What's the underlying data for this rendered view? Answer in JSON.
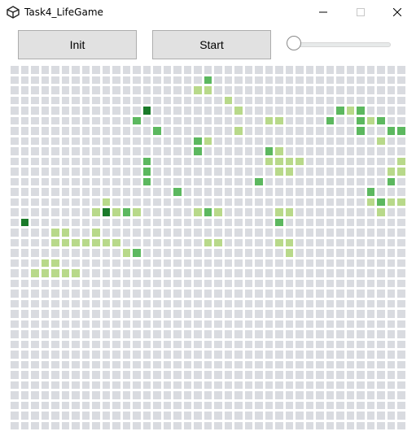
{
  "window": {
    "title": "Task4_LifeGame",
    "app_icon": "unity-icon",
    "controls": [
      "minimize-icon",
      "maximize-icon",
      "close-icon"
    ]
  },
  "toolbar": {
    "init_label": "Init",
    "start_label": "Start",
    "speed_slider_value": 0.0
  },
  "grid": {
    "columns": 39,
    "rows": 36,
    "colors": {
      "empty": "#d9dbe0",
      "1": "#b8d98a",
      "2": "#5cb85f",
      "3": "#1a7a2a"
    },
    "cells": [
      "0000000000000000000000000000000000000000",
      "0000000000000000000200000000000000000000",
      "0000000000000000001100000000000000000000",
      "0000000000000000000001000000000000000000",
      "0000000000000300000000100000000021200000",
      "0000000000002000000000000110000200212000",
      "0000000000000020000000100000000000200220",
      "0000000000000000002100000000000000001000",
      "0000000000000000002000000210000000000000",
      "0000000000000200000000000111100000000010",
      "0000000000000200000000000011000000000110",
      "0000000000000200000000002000000000000202",
      "0000000000000000200000000000000000020000",
      "0000000001000000000000000000000000012110",
      "0000000013121000001210000011000000001000",
      "0300000000000000000000000020000000000000",
      "0000110010000000000000000000000000000000",
      "0000111111100000000110000011000000000000",
      "0000000000012000000000000001000000000000",
      "0001100000000000000000000000000000000000",
      "0011111000000000000000000000000000000000",
      "0000000000000000000000000000000000000000",
      "0000000000000000000000000000000000000000",
      "0000000000000000000000000000000000000000",
      "0000000000000000000000000000000000000000",
      "0000000000000000000000000000000000000000",
      "0000000000000000000000000000000000000000",
      "0000000000000000000000000000000000000000",
      "0000000000000000000000000000000000000000",
      "0000000000000000000000000000000000000000",
      "0000000000000000000000000000000000000000",
      "0000000000000000000000000000000000000000",
      "0000000000000000000000000000000000000000",
      "0000000000000000000000000000000000000000",
      "0000000000000000000000000000000000000000",
      "0000000000000000000000000000000000000000"
    ]
  }
}
